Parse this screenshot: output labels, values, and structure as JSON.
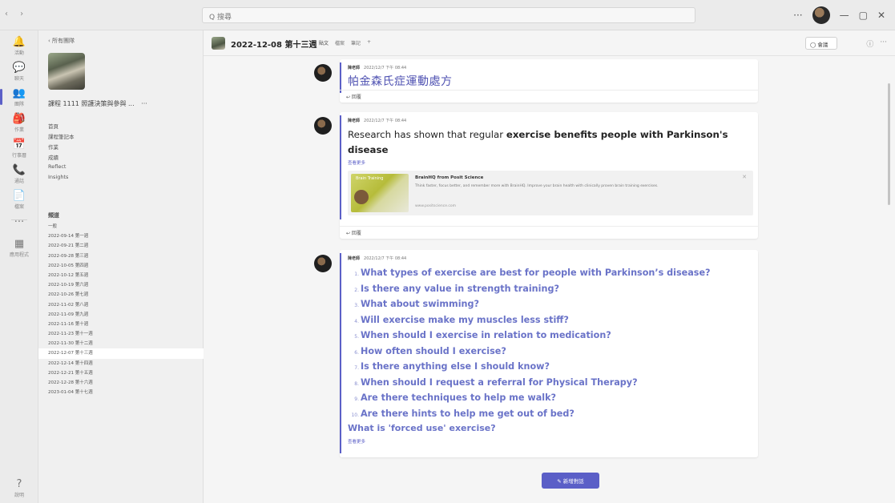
{
  "topbar": {
    "nav": "‹ ›",
    "search_placeholder": "Q 搜尋",
    "window_controls": [
      "···",
      "—",
      "▢",
      "✕"
    ]
  },
  "rail": {
    "items": [
      {
        "icon": "activity-icon",
        "glyph": "🔔",
        "label": "活動"
      },
      {
        "icon": "chat-icon",
        "glyph": "💬",
        "label": "聊天"
      },
      {
        "icon": "teams-icon",
        "glyph": "👥",
        "label": "團隊"
      },
      {
        "icon": "assignments-icon",
        "glyph": "🎒",
        "label": "作業"
      },
      {
        "icon": "calendar-icon",
        "glyph": "📅",
        "label": "行事曆"
      },
      {
        "icon": "calls-icon",
        "glyph": "📞",
        "label": "通話"
      },
      {
        "icon": "files-icon",
        "glyph": "📄",
        "label": "檔案"
      },
      {
        "icon": "more-icon",
        "glyph": "···",
        "label": ""
      },
      {
        "icon": "apps-icon",
        "glyph": "▦",
        "label": "應用程式"
      },
      {
        "icon": "help-icon",
        "glyph": "?",
        "label": "說明"
      }
    ]
  },
  "panel": {
    "back": "‹ 所有團隊",
    "team_name": "課程 1111 照護決策與參與 ...",
    "team_more": "···",
    "links": [
      "首頁",
      "課程筆記本",
      "作業",
      "成績",
      "Reflect",
      "Insights"
    ],
    "section": "頻道",
    "channels": [
      "一般",
      "2022-09-14 第一週",
      "2022-09-21 第二週",
      "2022-09-28 第三週",
      "2022-10-05 第四週",
      "2022-10-12 第五週",
      "2022-10-19 第六週",
      "2022-10-26 第七週",
      "2022-11-02 第八週",
      "2022-11-09 第九週",
      "2022-11-16 第十週",
      "2022-11-23 第十一週",
      "2022-11-30 第十二週",
      "2022-12-07 第十三週",
      "2022-12-14 第十四週",
      "2022-12-21 第十五週",
      "2022-12-28 第十六週",
      "2023-01-04 第十七週"
    ],
    "active_channel_index": 13
  },
  "header": {
    "title": "2022-12-08 第十三週",
    "tabs": [
      "貼文",
      "檔案",
      "筆記",
      "+"
    ],
    "meet_label": "◯ 會議",
    "icons": [
      "ⓘ",
      "···"
    ]
  },
  "posts": [
    {
      "author": "陳老師",
      "time": "2022/12/7 下午 08:44",
      "link_text": "帕金森氏症運動處方",
      "reply": "↩ 回覆"
    },
    {
      "author": "陳老師",
      "time": "2022/12/7 下午 08:44",
      "text_pre": "Research has shown that regular ",
      "text_bold": "exercise benefits people with Parkinson's disease",
      "see_more": "查看更多",
      "preview": {
        "image_label": "Brain Training",
        "title": "BrainHQ from Posit Science",
        "description": "Think faster, focus better, and remember more with BrainHQ. Improve your brain health with clinically proven brain training exercises.",
        "url": "www.positscience.com",
        "close": "✕"
      },
      "reply": "↩ 回覆"
    },
    {
      "author": "陳老師",
      "time": "2022/12/7 下午 08:44",
      "questions": [
        "What types of exercise are best for people with Parkinson’s disease?",
        "Is there any value in strength training?",
        "What about swimming?",
        "Will exercise make my muscles less stiff?",
        "When should I exercise in relation to medication?",
        "How often should I exercise?",
        "Is there anything else I should know?",
        "When should I request a referral for Physical Therapy?",
        "Are there techniques to help me walk?",
        "Are there hints to help me get out of bed?"
      ],
      "numbers": [
        "1.",
        "2.",
        "3.",
        "4.",
        "5.",
        "6.",
        "7.",
        "8.",
        "9.",
        "10."
      ],
      "forced_use": "What is 'forced use' exercise?",
      "see_more": "查看更多"
    }
  ],
  "new_post_button": "✎ 新增對話",
  "colors": {
    "accent": "#5b5fc7",
    "question": "#6a73c8"
  }
}
